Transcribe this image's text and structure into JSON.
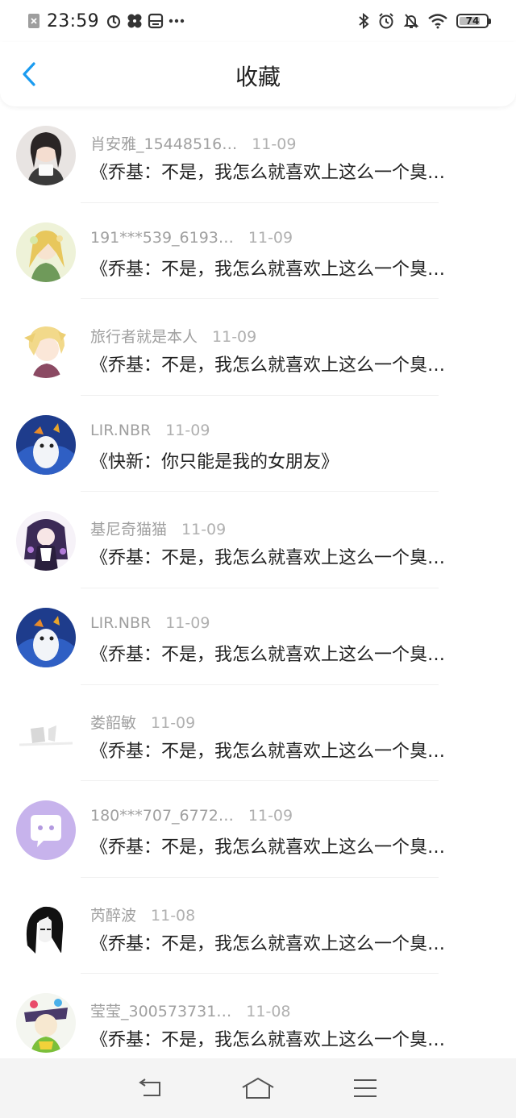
{
  "status": {
    "time": "23:59",
    "battery": "74"
  },
  "header": {
    "title": "收藏"
  },
  "items": [
    {
      "name": "肖安雅_15448516…",
      "date": "11-09",
      "message": "《乔基：不是，我怎么就喜欢上这么一个臭…"
    },
    {
      "name": "191***539_6193…",
      "date": "11-09",
      "message": "《乔基：不是，我怎么就喜欢上这么一个臭…"
    },
    {
      "name": "旅行者就是本人",
      "date": "11-09",
      "message": "《乔基：不是，我怎么就喜欢上这么一个臭…"
    },
    {
      "name": "LIR.NBR",
      "date": "11-09",
      "message": "《快新：你只能是我的女朋友》"
    },
    {
      "name": "基尼奇猫猫",
      "date": "11-09",
      "message": "《乔基：不是，我怎么就喜欢上这么一个臭…"
    },
    {
      "name": "LIR.NBR",
      "date": "11-09",
      "message": "《乔基：不是，我怎么就喜欢上这么一个臭…"
    },
    {
      "name": "娄韶敏",
      "date": "11-09",
      "message": "《乔基：不是，我怎么就喜欢上这么一个臭…"
    },
    {
      "name": "180***707_6772…",
      "date": "11-09",
      "message": "《乔基：不是，我怎么就喜欢上这么一个臭…"
    },
    {
      "name": "芮醉波",
      "date": "11-08",
      "message": "《乔基：不是，我怎么就喜欢上这么一个臭…"
    },
    {
      "name": "莹莹_300573731…",
      "date": "11-08",
      "message": "《乔基：不是，我怎么就喜欢上这么一个臭…"
    }
  ],
  "colors": {
    "accent": "#1a9bf0",
    "nav_bg": "#f4f4f4"
  }
}
